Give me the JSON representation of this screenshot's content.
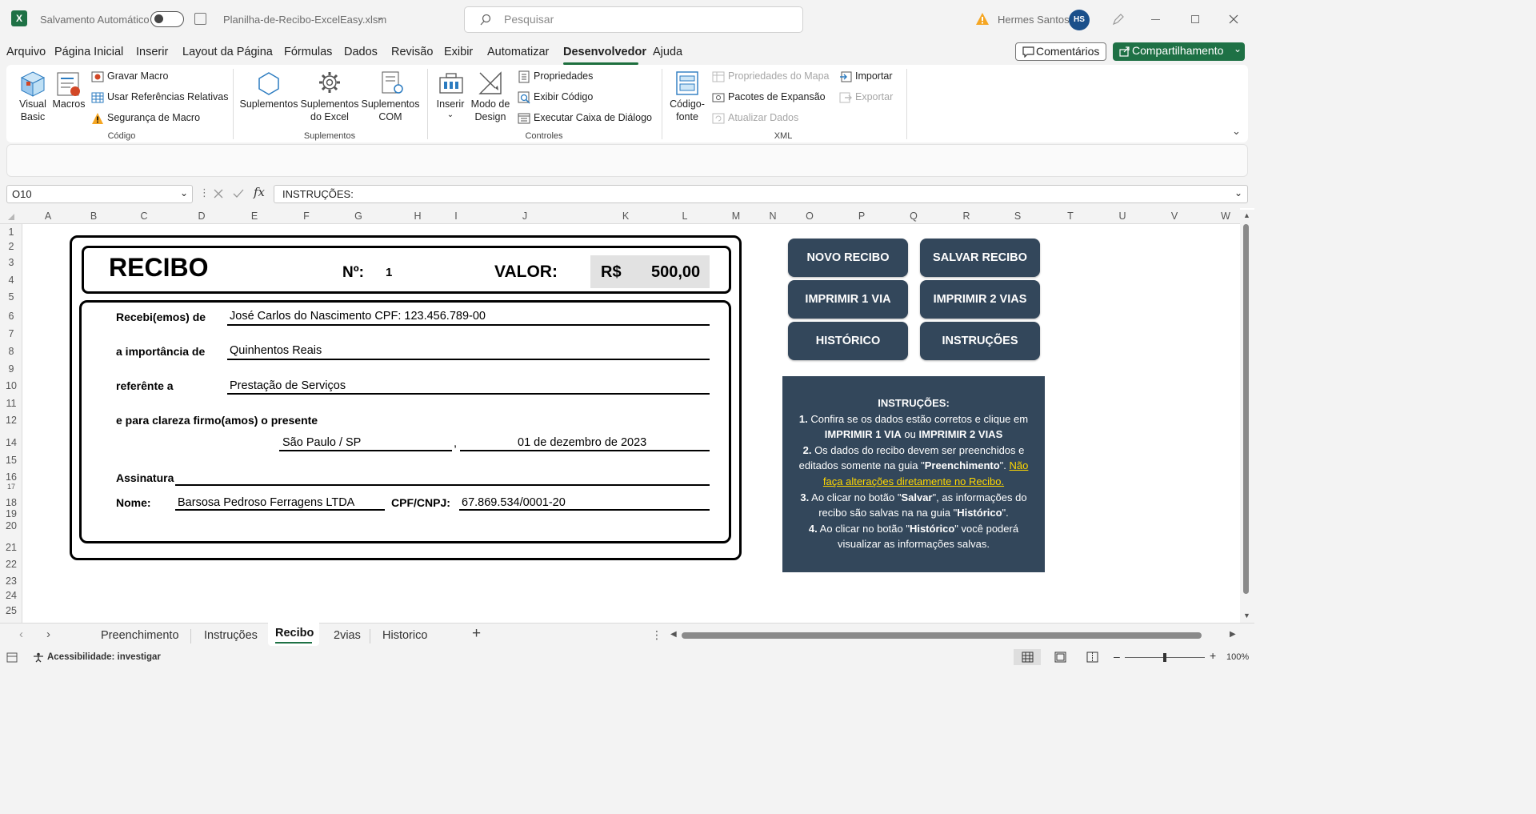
{
  "titlebar": {
    "autosave_label": "Salvamento Automático",
    "filename": "Planilha-de-Recibo-ExcelEasy.xlsm",
    "search_placeholder": "Pesquisar",
    "user_name": "Hermes Santos",
    "user_initials": "HS"
  },
  "menu": {
    "items": [
      "Arquivo",
      "Página Inicial",
      "Inserir",
      "Layout da Página",
      "Fórmulas",
      "Dados",
      "Revisão",
      "Exibir",
      "Automatizar",
      "Desenvolvedor",
      "Ajuda"
    ],
    "active": "Desenvolvedor",
    "comments_label": "Comentários",
    "share_label": "Compartilhamento"
  },
  "ribbon": {
    "codigo": {
      "group_label": "Código",
      "visual_basic": "Visual Basic",
      "macros": "Macros",
      "gravar_macro": "Gravar Macro",
      "referencias_relativas": "Usar Referências Relativas",
      "seguranca_macro": "Segurança de Macro"
    },
    "suplementos": {
      "group_label": "Suplementos",
      "suplementos": "Suplementos",
      "suplementos_excel": "Suplementos do Excel",
      "suplementos_com": "Suplementos COM"
    },
    "controles": {
      "group_label": "Controles",
      "inserir": "Inserir",
      "modo_design": "Modo de Design",
      "propriedades": "Propriedades",
      "exibir_codigo": "Exibir Código",
      "executar_caixa": "Executar Caixa de Diálogo"
    },
    "xml": {
      "group_label": "XML",
      "codigo_fonte": "Código-fonte",
      "propriedades_mapa": "Propriedades do Mapa",
      "pacotes_expansao": "Pacotes de Expansão",
      "atualizar_dados": "Atualizar Dados",
      "importar": "Importar",
      "exportar": "Exportar"
    }
  },
  "formula_bar": {
    "cell_ref": "O10",
    "fx": "fx",
    "content": "INSTRUÇÕES:"
  },
  "columns": [
    "A",
    "B",
    "C",
    "D",
    "E",
    "F",
    "G",
    "H",
    "I",
    "J",
    "K",
    "L",
    "M",
    "N",
    "O",
    "P",
    "Q",
    "R",
    "S",
    "T",
    "U",
    "V",
    "W"
  ],
  "rows": [
    "1",
    "2",
    "3",
    "4",
    "5",
    "6",
    "7",
    "8",
    "9",
    "10",
    "11",
    "12",
    "14",
    "15",
    "16",
    "17",
    "18",
    "19",
    "20",
    "21",
    "22",
    "23",
    "24",
    "25"
  ],
  "receipt": {
    "title": "RECIBO",
    "number_label": "Nº:",
    "number": "1",
    "valor_label": "VALOR:",
    "currency": "R$",
    "amount": "500,00",
    "recebi_label": "Recebi(emos) de",
    "recebi_value": "José Carlos do Nascimento CPF: 123.456.789-00",
    "importancia_label": "a importância de",
    "importancia_value": "Quinhentos Reais",
    "referente_label": "referênte a",
    "referente_value": "Prestação de Serviços",
    "clareza_label": "e para clareza firmo(amos) o presente",
    "city": "São Paulo / SP",
    "comma": ",",
    "date": "01 de dezembro de 2023",
    "assinatura_label": "Assinatura",
    "nome_label": "Nome:",
    "nome_value": "Barsosa Pedroso Ferragens LTDA",
    "cpf_label": "CPF/CNPJ:",
    "cpf_value": "67.869.534/0001-20"
  },
  "buttons": {
    "novo": "NOVO RECIBO",
    "salvar": "SALVAR RECIBO",
    "imprimir1": "IMPRIMIR 1 VIA",
    "imprimir2": "IMPRIMIR 2 VIAS",
    "historico": "HISTÓRICO",
    "instrucoes": "INSTRUÇÕES"
  },
  "instructions": {
    "title": "INSTRUÇÕES:",
    "i1_num": "1.",
    "i1_a": " Confira se os dados estão corretos e clique em",
    "i1_b1": "IMPRIMIR 1 VIA",
    "i1_or": " ou ",
    "i1_b2": "IMPRIMIR 2 VIAS",
    "i2_num": "2.",
    "i2_a": " Os dados do recibo devem ser preenchidos e",
    "i2_b": "editados somente na guia \"",
    "i2_bold": "Preenchimento",
    "i2_c": "\". ",
    "i2_link1": "Não",
    "i2_link2": "faça alterações diretamente no Recibo.",
    "i3_num": "3.",
    "i3_a": " Ao clicar no botão \"",
    "i3_bold": "Salvar",
    "i3_b": "\", as informações do",
    "i3_c": "recibo são salvas na na guia \"",
    "i3_bold2": "Histórico",
    "i3_d": "\".",
    "i4_num": "4.",
    "i4_a": " Ao clicar no botão \"",
    "i4_bold": "Histórico",
    "i4_b": "\" você poderá",
    "i4_c": "visualizar as informações salvas."
  },
  "sheet_tabs": [
    "Preenchimento",
    "Instruções",
    "Recibo",
    "2vias",
    "Historico"
  ],
  "active_tab": "Recibo",
  "status": {
    "accessibility": "Acessibilidade: investigar",
    "zoom": "100%"
  }
}
